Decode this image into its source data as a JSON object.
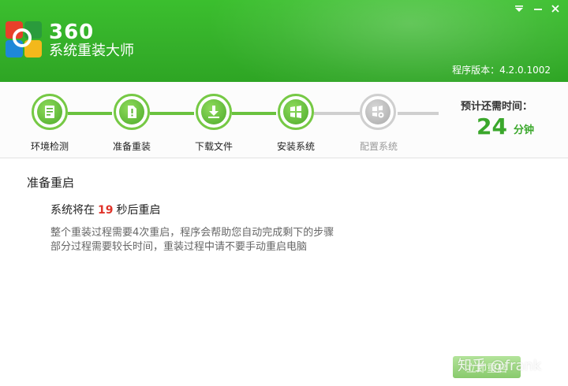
{
  "window": {
    "menu_icon": "menu-down-icon",
    "min_icon": "minimize-icon",
    "close_icon": "close-icon"
  },
  "header": {
    "brand_number": "360",
    "brand_name": "系统重装大师",
    "version": "程序版本：4.2.0.1002"
  },
  "steps": [
    {
      "label": "环境检测",
      "icon": "environment-check-icon",
      "status": "done"
    },
    {
      "label": "准备重装",
      "icon": "prepare-reinstall-icon",
      "status": "done"
    },
    {
      "label": "下载文件",
      "icon": "download-icon",
      "status": "done"
    },
    {
      "label": "安装系统",
      "icon": "install-system-icon",
      "status": "current"
    },
    {
      "label": "配置系统",
      "icon": "configure-system-icon",
      "status": "pending"
    }
  ],
  "eta": {
    "label": "预计还需时间：",
    "value": "24",
    "unit": "分钟"
  },
  "content": {
    "title": "准备重启",
    "restart_prefix": "系统将在",
    "restart_seconds": "19",
    "restart_suffix": "秒后重启",
    "desc1": "整个重装过程需要4次重启，程序会帮助您自动完成剩下的步骤",
    "desc2": "部分过程需要较长时间，重装过程中请不要手动重启电脑"
  },
  "footer": {
    "action_button": "立即重启",
    "watermark": "知乎 @frank"
  },
  "colors": {
    "header_green": "#35b02a",
    "progress_green": "#6ac23f",
    "eta_green": "#3aa72b",
    "countdown_red": "#e0342a"
  }
}
